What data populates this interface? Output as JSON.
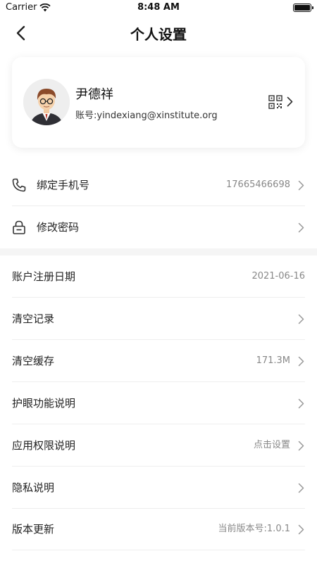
{
  "status_bar": {
    "carrier": "Carrier",
    "time": "8:48 AM"
  },
  "nav": {
    "title": "个人设置"
  },
  "profile": {
    "name": "尹德祥",
    "account": "账号:yindexiang@xinstitute.org"
  },
  "account_rows": [
    {
      "label": "绑定手机号",
      "value": "17665466698"
    },
    {
      "label": "修改密码",
      "value": ""
    }
  ],
  "settings_rows": [
    {
      "label": "账户注册日期",
      "value": "2021-06-16"
    },
    {
      "label": "清空记录",
      "value": ""
    },
    {
      "label": "清空缓存",
      "value": "171.3M"
    },
    {
      "label": "护眼功能说明",
      "value": ""
    },
    {
      "label": "应用权限说明",
      "value": "点击设置"
    },
    {
      "label": "隐私说明",
      "value": ""
    },
    {
      "label": "版本更新",
      "value": "当前版本号:1.0.1"
    }
  ]
}
